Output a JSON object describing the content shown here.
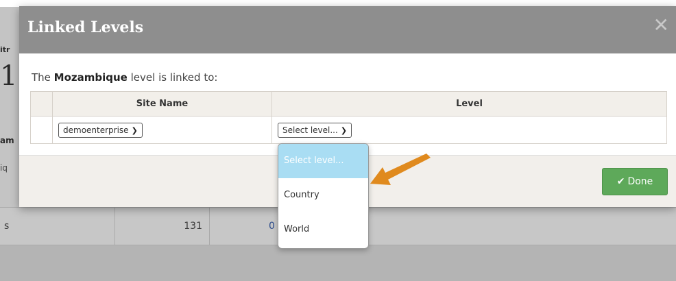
{
  "background": {
    "frag_1": "itr",
    "frag_2": "1:",
    "frag_3": "am",
    "frag_4": "iq",
    "row": {
      "col_a": "s",
      "col_b": "131",
      "col_c": "0"
    }
  },
  "modal": {
    "title": "Linked Levels",
    "close_glyph": "✕",
    "intro_prefix": "The ",
    "intro_country": "Mozambique",
    "intro_suffix": " level is linked to:",
    "table": {
      "headers": [
        "",
        "Site Name",
        "Level"
      ],
      "row": {
        "site_value": "demoenterprise",
        "level_value": "Select level..."
      }
    },
    "done_label": "Done"
  },
  "dropdown": {
    "options": [
      "Select level...",
      "Country",
      "World"
    ],
    "selected_index": 0
  },
  "colors": {
    "accent_arrow": "#e08a1e",
    "done_green": "#5ea95a",
    "option_highlight": "#a9ddf3"
  }
}
